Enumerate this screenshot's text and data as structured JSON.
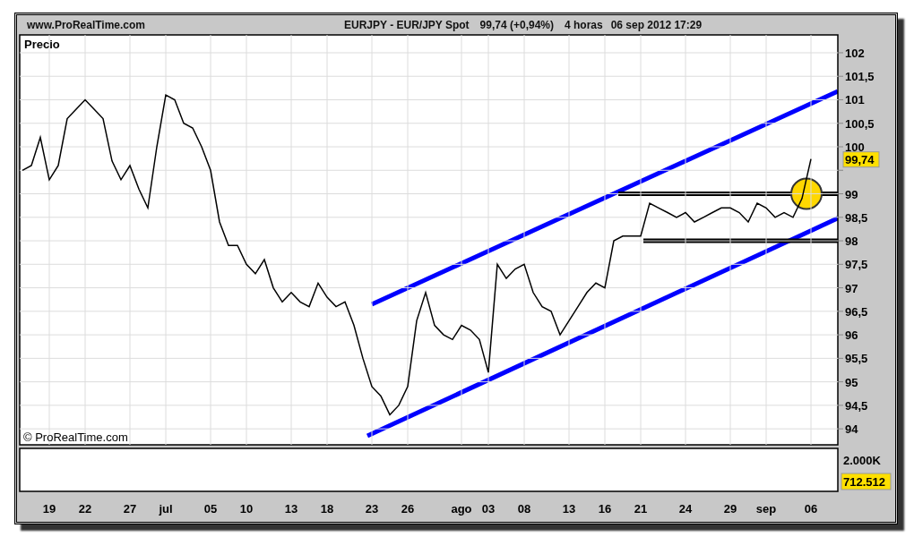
{
  "header": {
    "site": "www.ProRealTime.com",
    "instrument": "EURJPY - EUR/JPY Spot",
    "quote": "99,74 (+0,94%)",
    "timeframe": "4 horas",
    "datetime": "06 sep 2012 17:29"
  },
  "price_panel": {
    "label": "Precio",
    "copyright": "© ProRealTime.com",
    "last_price": "99,74",
    "chart_data": {
      "type": "line",
      "grid": true,
      "ylim": [
        93.66,
        102.38
      ],
      "categories": [
        null,
        null,
        null,
        "19",
        null,
        null,
        null,
        "22",
        null,
        null,
        null,
        null,
        "27",
        null,
        null,
        null,
        "jul",
        null,
        null,
        null,
        null,
        "05",
        null,
        null,
        null,
        "10",
        null,
        null,
        null,
        null,
        "13",
        null,
        null,
        null,
        "18",
        null,
        null,
        null,
        null,
        "23",
        null,
        null,
        null,
        "26",
        null,
        null,
        null,
        null,
        null,
        "ago",
        null,
        null,
        "03",
        null,
        null,
        null,
        "08",
        null,
        null,
        null,
        null,
        "13",
        null,
        null,
        null,
        "16",
        null,
        null,
        null,
        "21",
        null,
        null,
        null,
        null,
        "24",
        null,
        null,
        null,
        null,
        "29",
        null,
        null,
        null,
        "sep",
        null,
        null,
        null,
        null,
        "06"
      ],
      "series": [
        {
          "color": "#000000",
          "values": [
            99.5,
            99.6,
            100.2,
            99.3,
            99.6,
            100.6,
            100.8,
            101.0,
            100.8,
            100.6,
            99.7,
            99.3,
            99.6,
            99.1,
            98.7,
            100.0,
            101.1,
            101.0,
            100.5,
            100.4,
            100.0,
            99.5,
            98.4,
            97.9,
            97.9,
            97.5,
            97.3,
            97.6,
            97.0,
            96.7,
            96.9,
            96.7,
            96.6,
            97.1,
            96.8,
            96.6,
            96.7,
            96.2,
            95.5,
            94.9,
            94.7,
            94.3,
            94.5,
            94.9,
            96.3,
            96.9,
            96.2,
            96.0,
            95.9,
            96.2,
            96.1,
            95.9,
            95.2,
            97.5,
            97.2,
            97.4,
            97.5,
            96.9,
            96.6,
            96.5,
            96.0,
            96.3,
            96.6,
            96.9,
            97.1,
            97.0,
            98.0,
            98.1,
            98.1,
            98.1,
            98.8,
            98.7,
            98.6,
            98.5,
            98.6,
            98.4,
            98.5,
            98.6,
            98.7,
            98.7,
            98.6,
            98.4,
            98.8,
            98.7,
            98.5,
            98.6,
            98.5,
            98.9,
            99.74
          ]
        }
      ],
      "yticks": [
        {
          "value": 94,
          "label": "94"
        },
        {
          "value": 94.5,
          "label": "94,5"
        },
        {
          "value": 95,
          "label": "95"
        },
        {
          "value": 95.5,
          "label": "95,5"
        },
        {
          "value": 96,
          "label": "96"
        },
        {
          "value": 96.5,
          "label": "96,5"
        },
        {
          "value": 97,
          "label": "97"
        },
        {
          "value": 97.5,
          "label": "97,5"
        },
        {
          "value": 98,
          "label": "98"
        },
        {
          "value": 98.5,
          "label": "98,5"
        },
        {
          "value": 99,
          "label": "99"
        },
        {
          "value": 100,
          "label": "100"
        },
        {
          "value": 100.5,
          "label": "100,5"
        },
        {
          "value": 101,
          "label": "101"
        },
        {
          "value": 101.5,
          "label": "101,5"
        },
        {
          "value": 102,
          "label": "102"
        }
      ]
    }
  },
  "volume_panel": {
    "scale": "2.000K",
    "last_volume": "712.512"
  }
}
